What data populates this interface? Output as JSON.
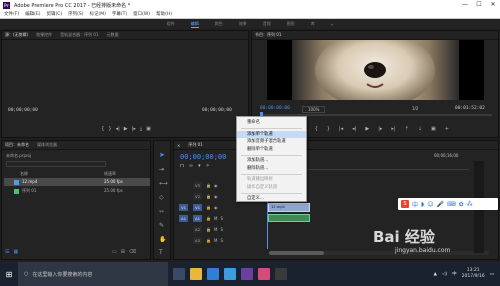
{
  "window": {
    "app_badge": "Pr",
    "title": "Adobe Premiere Pro CC 2017 - 已经排版未命名 *",
    "controls": [
      "—",
      "☐",
      "✕"
    ]
  },
  "menubar": [
    "文件(F)",
    "编辑(E)",
    "剪辑(C)",
    "序列(S)",
    "标记(M)",
    "字幕(T)",
    "窗口(W)",
    "帮助(H)"
  ],
  "workspaces": {
    "items": [
      "组件",
      "编辑",
      "颜色",
      "效果",
      "音频",
      "图形",
      "库"
    ],
    "active_index": 1,
    "more": "»"
  },
  "source_panel": {
    "tabs": [
      "源：(无剪辑)",
      "效果控件",
      "音轨混合器：序列 01",
      "元数据"
    ],
    "tc_left": "00;00;00;00",
    "tc_right": "00;00;00;00"
  },
  "program_panel": {
    "tab": "节目：序列 01",
    "tc_current": "00:00:00:00",
    "zoom": "100%",
    "fraction": "1/2",
    "tc_duration": "00:01:52:02"
  },
  "project_panel": {
    "tabs": [
      "项目：未命名",
      "媒体浏览器"
    ],
    "file": "未命名.prproj",
    "columns": [
      "名称",
      "帧速率"
    ],
    "items": [
      {
        "name": "12.mp4",
        "fps": "25.00 fps",
        "color": "#48a0e8"
      },
      {
        "name": "序列 01",
        "fps": "25.00 fps",
        "color": "#4cc070"
      }
    ]
  },
  "timeline": {
    "tab": "序列 01",
    "tc": "00;00;00;00",
    "video_tracks": [
      "V3",
      "V2",
      "V1"
    ],
    "audio_tracks": [
      "A1",
      "A2",
      "A3"
    ],
    "src_v": "V1",
    "src_a": "A1",
    "clip_label": "12.mp4",
    "ruler_tc": "00;00;16;00"
  },
  "context_menu": {
    "items": [
      {
        "label": "重命名",
        "state": "normal"
      },
      {
        "sep": true
      },
      {
        "label": "添加单个轨道",
        "state": "highlight"
      },
      {
        "label": "添加音频子混合轨道",
        "state": "normal"
      },
      {
        "label": "删除单个轨道",
        "state": "normal"
      },
      {
        "sep": true
      },
      {
        "label": "添加轨道...",
        "state": "normal"
      },
      {
        "label": "删除轨道...",
        "state": "normal"
      },
      {
        "sep": true
      },
      {
        "label": "轨道输出映射",
        "state": "disabled"
      },
      {
        "label": "操作自定义轨道",
        "state": "disabled"
      },
      {
        "sep": true
      },
      {
        "label": "自定义...",
        "state": "normal"
      }
    ]
  },
  "taskbar": {
    "start": "⊞",
    "search_placeholder": "在这里输入你要搜索的内容",
    "clock_time": "13:21",
    "clock_date": "2017/9/16",
    "lang": "中"
  },
  "ime": {
    "logo": "S"
  },
  "watermark": {
    "brand": "Bai 经验",
    "url": "jingyan.baidu.com"
  }
}
